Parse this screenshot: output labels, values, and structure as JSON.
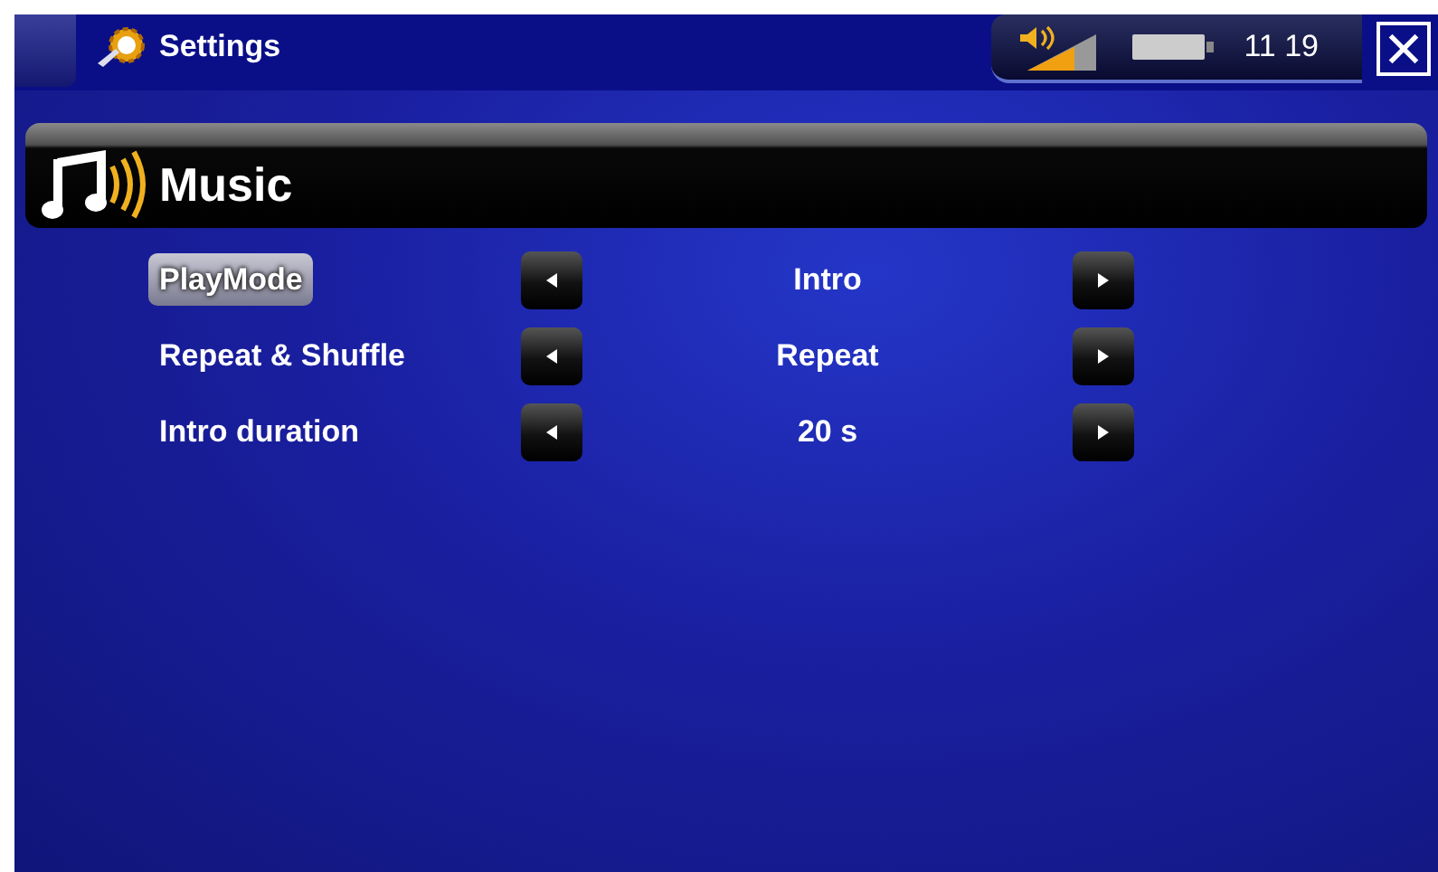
{
  "window": {
    "title": "Settings",
    "time": "11 19"
  },
  "section": {
    "title": "Music"
  },
  "settings": [
    {
      "label": "PlayMode",
      "value": "Intro",
      "selected": true
    },
    {
      "label": "Repeat & Shuffle",
      "value": "Repeat",
      "selected": false
    },
    {
      "label": "Intro duration",
      "value": "20 s",
      "selected": false
    }
  ]
}
